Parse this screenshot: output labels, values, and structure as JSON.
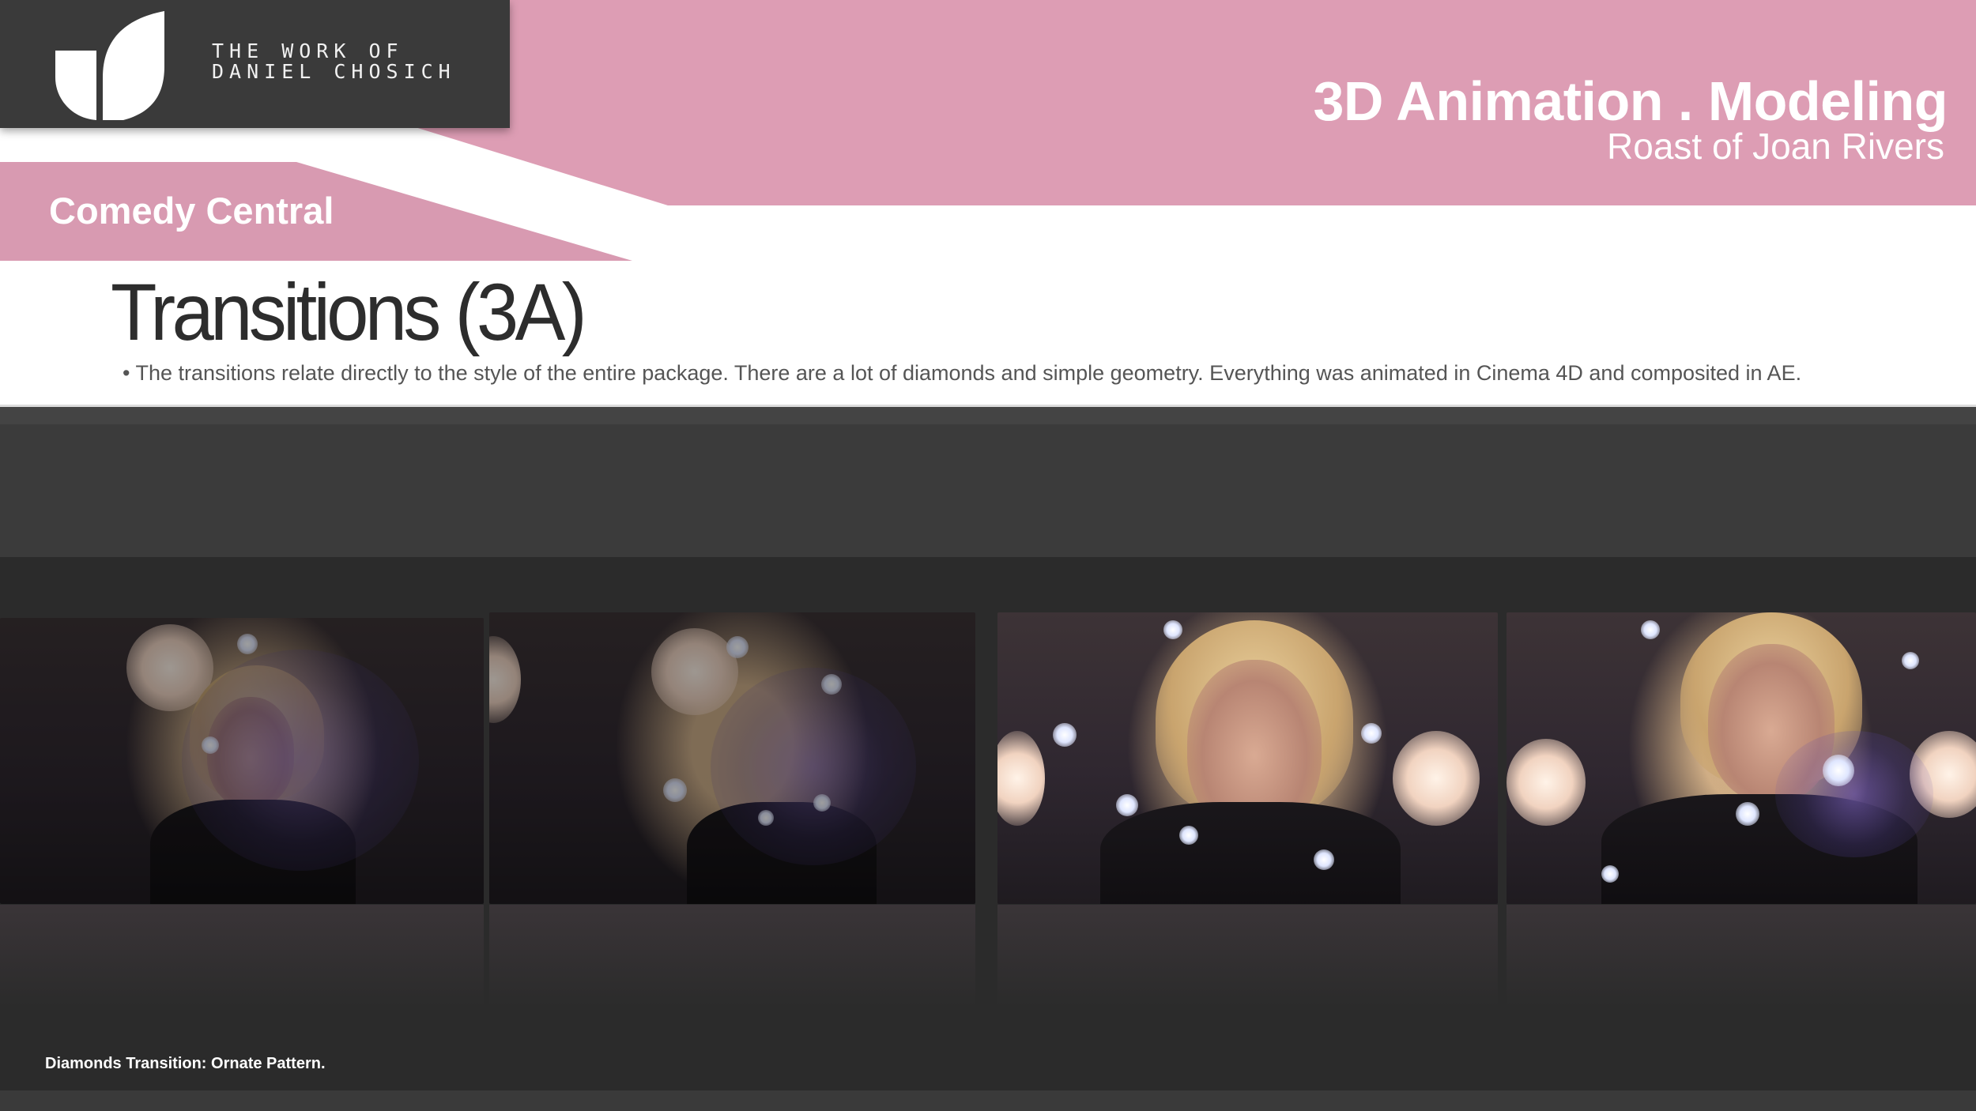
{
  "brand": {
    "logo_line1": "THE WORK OF",
    "logo_line2": "DANIEL CHOSICH",
    "logo_icon": "leaf-mark-icon"
  },
  "header": {
    "title": "3D Animation . Modeling",
    "subtitle": "Roast of Joan Rivers",
    "client": "Comedy Central"
  },
  "section": {
    "heading": "Transitions (3A)",
    "bullet": "• The transitions relate directly to the style of the entire package.  There are a lot of diamonds and simple geometry.  Everything was animated in Cinema 4D and composited in AE."
  },
  "caption": "Diamonds Transition:  Ornate Pattern.",
  "colors": {
    "pink": "#dd9db4",
    "dark": "#3a3a3a",
    "panel": "#2b2b2b",
    "text": "#555555"
  }
}
